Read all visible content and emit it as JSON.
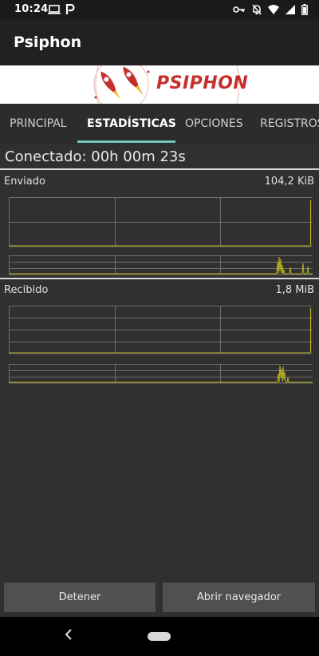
{
  "status_bar": {
    "time": "10:24",
    "icons": [
      "laptop-icon",
      "psiphon-p-icon",
      "vpn-key-icon",
      "bell-off-icon",
      "wifi-icon",
      "signal-icon",
      "battery-icon"
    ]
  },
  "app_bar": {
    "title": "Psiphon"
  },
  "banner": {
    "logo_text": "PSIPHON"
  },
  "tabs": [
    {
      "label": "PRINCIPAL",
      "active": false
    },
    {
      "label": "ESTADÍSTICAS",
      "active": true
    },
    {
      "label": "OPCIONES",
      "active": false
    },
    {
      "label": "REGISTROS",
      "active": false
    }
  ],
  "connection": {
    "status_text": "Conectado: 00h 00m 23s"
  },
  "stats": {
    "sent": {
      "label": "Enviado",
      "value": "104,2 KiB"
    },
    "received": {
      "label": "Recibido",
      "value": "1,8 MiB"
    }
  },
  "colors": {
    "graph_line": "#b8b21c",
    "grid": "#6e6e6e",
    "tab_indicator": "#74c6c0",
    "background": "#303030"
  },
  "buttons": {
    "stop": "Detener",
    "open_browser": "Abrir navegador"
  }
}
